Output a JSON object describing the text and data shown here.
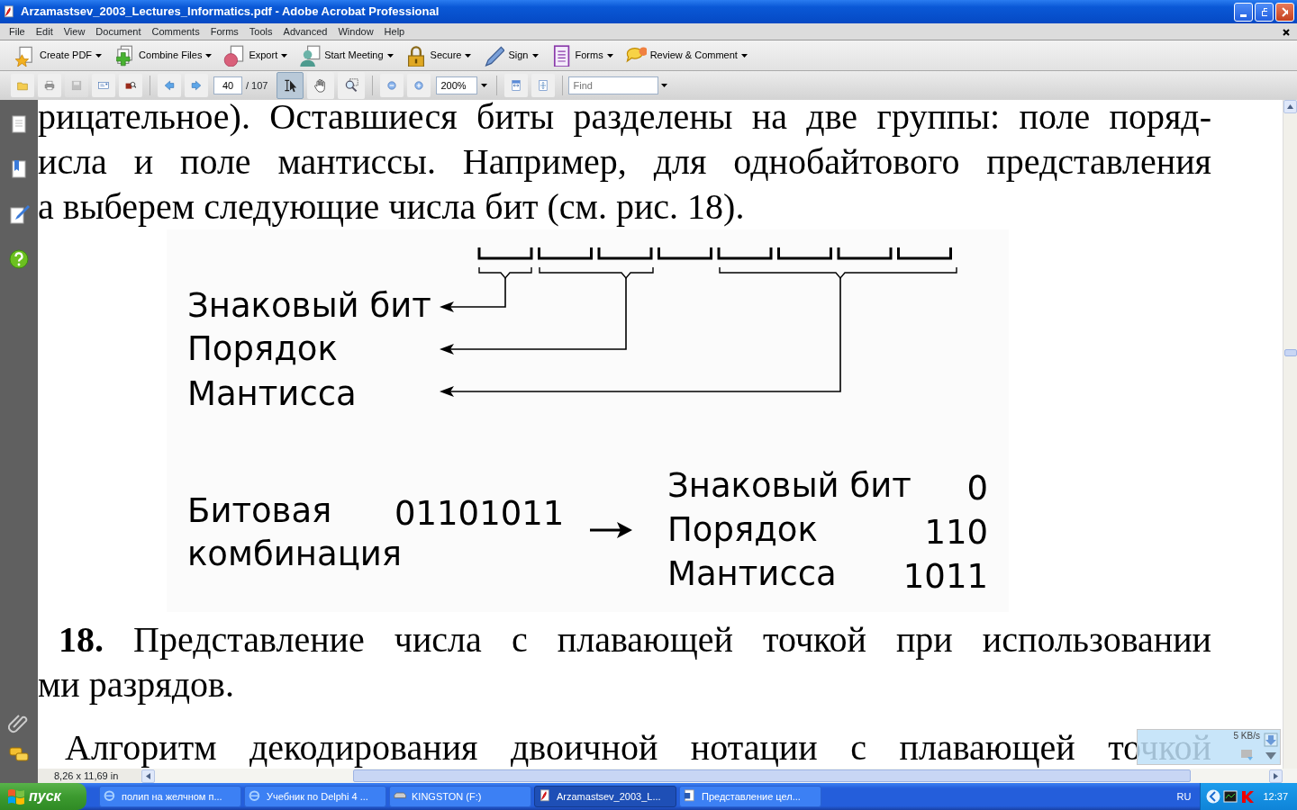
{
  "window": {
    "title": "Arzamastsev_2003_Lectures_Informatics.pdf - Adobe Acrobat Professional"
  },
  "menu": [
    "File",
    "Edit",
    "View",
    "Document",
    "Comments",
    "Forms",
    "Tools",
    "Advanced",
    "Window",
    "Help"
  ],
  "task_toolbar": [
    {
      "kind": "create",
      "label": "Create PDF"
    },
    {
      "kind": "combine",
      "label": "Combine Files"
    },
    {
      "kind": "export",
      "label": "Export"
    },
    {
      "kind": "meeting",
      "label": "Start Meeting"
    },
    {
      "kind": "secure",
      "label": "Secure"
    },
    {
      "kind": "sign",
      "label": "Sign"
    },
    {
      "kind": "forms",
      "label": "Forms"
    },
    {
      "kind": "review",
      "label": "Review & Comment"
    }
  ],
  "file_buttons": [
    {
      "kind": "open",
      "disabled": false
    },
    {
      "kind": "print",
      "disabled": false
    },
    {
      "kind": "save",
      "disabled": true
    },
    {
      "kind": "email",
      "disabled": false
    },
    {
      "kind": "browse",
      "disabled": false
    }
  ],
  "page_nav": {
    "page": "40",
    "page_count": "/ 107"
  },
  "tools": [
    {
      "kind": "select",
      "selected": true
    },
    {
      "kind": "hand",
      "selected": false
    },
    {
      "kind": "marquee",
      "selected": false
    }
  ],
  "zoom": {
    "value": "200%"
  },
  "view_buttons": [
    {
      "kind": "fit-width"
    },
    {
      "kind": "fit-page"
    }
  ],
  "find": {
    "placeholder": "Find"
  },
  "sidebar": {
    "top": [
      {
        "kind": "pages"
      },
      {
        "kind": "bookmarks"
      },
      {
        "kind": "signatures"
      },
      {
        "kind": "help"
      }
    ],
    "bottom": [
      {
        "kind": "attachments"
      },
      {
        "kind": "comments"
      }
    ]
  },
  "document": {
    "intro_lines": [
      {
        "text": "рицательное). Оставшиеся биты разделены на две группы: поле поряд-",
        "justified": true
      },
      {
        "text": "исла и поле мантиссы. Например, для однобайтового представления",
        "justified": true
      },
      {
        "text": "а выберем следующие числа бит (см. рис. 18).",
        "justified": false
      }
    ],
    "figure": {
      "field_labels": [
        "Знаковый бит",
        "Порядок",
        "Мантисса"
      ],
      "example_label": [
        "Битовая",
        "комбинация"
      ],
      "bits": "01101011",
      "fields": [
        {
          "name": "Знаковый бит",
          "value": "0"
        },
        {
          "name": "Порядок",
          "value": "110"
        },
        {
          "name": "Мантисса",
          "value": "1011"
        }
      ]
    },
    "caption_lines": [
      {
        "text": "**18.** Представление числа с плавающей точкой при использовании",
        "justified": true
      },
      {
        "text": "ми разрядов.",
        "justified": false
      }
    ],
    "last_lines": [
      {
        "text": "Алгоритм декодирования двоичной нотации с плавающей точкой",
        "justified": true
      }
    ]
  },
  "status": {
    "page_size": "8,26 x 11,69 in"
  },
  "network_widget": {
    "speed": "5 KB/s"
  },
  "taskbar": {
    "start": "пуск",
    "tasks": [
      {
        "kind": "browser",
        "label": "полип на желчном п...",
        "selected": false
      },
      {
        "kind": "browser",
        "label": "Учебник по Delphi 4 ...",
        "selected": false
      },
      {
        "kind": "drive",
        "label": "KINGSTON (F:)",
        "selected": false
      },
      {
        "kind": "pdf",
        "label": "Arzamastsev_2003_L...",
        "selected": true
      },
      {
        "kind": "word",
        "label": "Представление цел...",
        "selected": false
      }
    ],
    "language": "RU",
    "clock": "12:37"
  }
}
